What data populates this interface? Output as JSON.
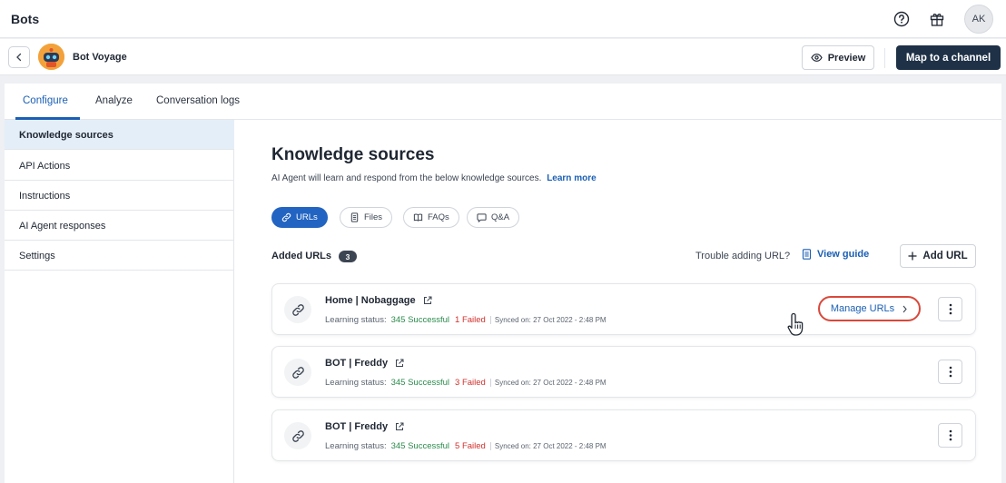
{
  "app": {
    "title": "Bots",
    "avatar_initials": "AK"
  },
  "icons": {
    "help": "help-circle-icon",
    "gift": "gift-icon",
    "back": "chevron-left-icon",
    "eye": "eye-icon",
    "link": "link-icon",
    "file": "file-icon",
    "faq": "book-icon",
    "qa": "chat-bubble-icon",
    "guide": "document-icon",
    "plus": "plus-icon",
    "external": "external-link-icon",
    "kebab": "more-vertical-icon",
    "chevron": "chevron-right-icon",
    "cursor": "hand-pointer-icon"
  },
  "bot": {
    "name": "Bot Voyage",
    "preview_label": "Preview",
    "map_label": "Map to a channel"
  },
  "tabs": [
    {
      "label": "Configure"
    },
    {
      "label": "Analyze"
    },
    {
      "label": "Conversation logs"
    }
  ],
  "sidebar": {
    "items": [
      {
        "label": "Knowledge sources"
      },
      {
        "label": "API Actions"
      },
      {
        "label": "Instructions"
      },
      {
        "label": "AI Agent responses"
      },
      {
        "label": "Settings"
      }
    ]
  },
  "main": {
    "title": "Knowledge sources",
    "subtitle": "AI Agent will learn and respond from the below knowledge sources.",
    "learn_more": "Learn more",
    "chips": [
      {
        "label": "URLs"
      },
      {
        "label": "Files"
      },
      {
        "label": "FAQs"
      },
      {
        "label": "Q&A"
      }
    ],
    "added_label": "Added URLs",
    "added_count": "3",
    "trouble": "Trouble adding URL?",
    "view_guide": "View guide",
    "add_url": "Add URL",
    "learning_label": "Learning status:",
    "manage_urls": "Manage URLs",
    "urls": [
      {
        "title": "Home | Nobaggage",
        "successful": "345 Successful",
        "failed": "1 Failed",
        "synced": "Synced on: 27 Oct 2022 - 2:48 PM"
      },
      {
        "title": "BOT | Freddy",
        "successful": "345 Successful",
        "failed": "3 Failed",
        "synced": "Synced on: 27 Oct 2022 - 2:48 PM"
      },
      {
        "title": "BOT | Freddy",
        "successful": "345 Successful",
        "failed": "5 Failed",
        "synced": "Synced on: 27 Oct 2022 - 2:48 PM"
      }
    ]
  },
  "colors": {
    "accent": "#1a5fb4",
    "primary_button": "#1e3147",
    "success": "#2a8a4b",
    "error": "#d0312d",
    "highlight_ring": "#d9483b",
    "active_nav": "#e4eef9"
  }
}
